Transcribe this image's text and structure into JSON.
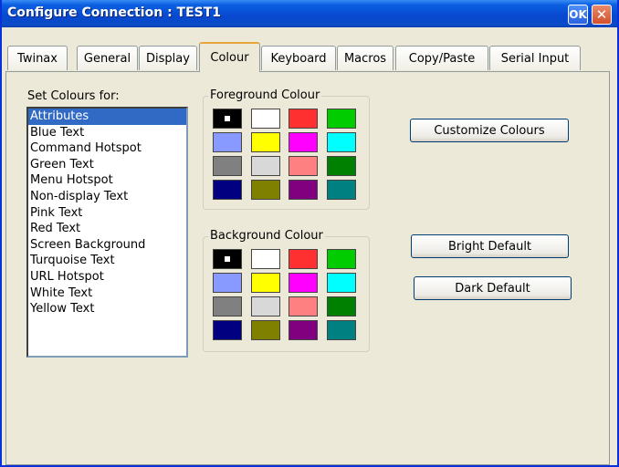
{
  "window": {
    "title": "Configure Connection : TEST1",
    "ok_label": "OK",
    "close_label": "✕"
  },
  "tabs": [
    {
      "label": "Twinax",
      "active": false
    },
    {
      "label": "General",
      "active": false
    },
    {
      "label": "Display",
      "active": false
    },
    {
      "label": "Colour",
      "active": true
    },
    {
      "label": "Keyboard",
      "active": false
    },
    {
      "label": "Macros",
      "active": false
    },
    {
      "label": "Copy/Paste",
      "active": false
    },
    {
      "label": "Serial Input",
      "active": false
    }
  ],
  "colour_panel": {
    "set_colours_label": "Set Colours for:",
    "items": [
      "Attributes",
      "Blue Text",
      "Command Hotspot",
      "Green Text",
      "Menu Hotspot",
      "Non-display Text",
      "Pink Text",
      "Red Text",
      "Screen Background",
      "Turquoise Text",
      "URL Hotspot",
      "White Text",
      "Yellow Text"
    ],
    "selected_item": "Attributes",
    "foreground": {
      "title": "Foreground Colour",
      "colors": [
        "#000000",
        "#ffffff",
        "#ff3030",
        "#00cc00",
        "#8899ff",
        "#ffff00",
        "#ff00ff",
        "#00ffff",
        "#808080",
        "#d8d8d8",
        "#ff8080",
        "#008000",
        "#000080",
        "#808000",
        "#800080",
        "#008080"
      ],
      "selected_index": 0
    },
    "background": {
      "title": "Background Colour",
      "colors": [
        "#000000",
        "#ffffff",
        "#ff3030",
        "#00cc00",
        "#8899ff",
        "#ffff00",
        "#ff00ff",
        "#00ffff",
        "#808080",
        "#d8d8d8",
        "#ff8080",
        "#008000",
        "#000080",
        "#808000",
        "#800080",
        "#008080"
      ],
      "selected_index": 0
    },
    "buttons": {
      "customize": "Customize Colours",
      "bright_default": "Bright Default",
      "dark_default": "Dark Default"
    }
  }
}
